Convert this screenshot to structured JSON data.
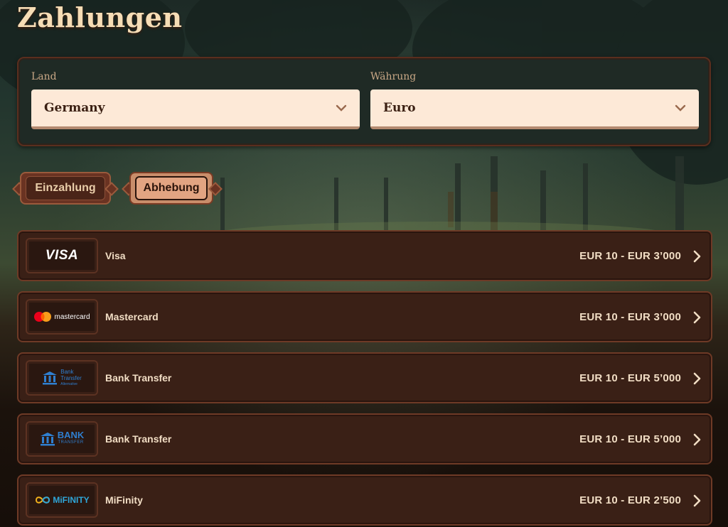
{
  "page": {
    "title": "Zahlungen"
  },
  "filters": {
    "country": {
      "label": "Land",
      "value": "Germany",
      "icon": "chevron-down-icon"
    },
    "currency": {
      "label": "Währung",
      "value": "Euro",
      "icon": "chevron-down-icon"
    }
  },
  "tabs": [
    {
      "label": "Einzahlung",
      "active": false
    },
    {
      "label": "Abhebung",
      "active": true
    }
  ],
  "methods": [
    {
      "logo": "VISA",
      "name": "Visa",
      "limits": "EUR 10 - EUR 3’000"
    },
    {
      "logo": "mastercard",
      "name": "Mastercard",
      "limits": "EUR 10 - EUR 3’000"
    },
    {
      "logo": "Bank Transfer Alternative",
      "logo_lines": [
        "Bank",
        "Transfer",
        "Alternative"
      ],
      "name": "Bank Transfer",
      "limits": "EUR 10 - EUR 5’000"
    },
    {
      "logo": "BANK TRANSFER",
      "logo_lines": [
        "BANK",
        "TRANSFER"
      ],
      "name": "Bank Transfer",
      "limits": "EUR 10 - EUR 5’000"
    },
    {
      "logo": "MiFINITY",
      "name": "MiFinity",
      "limits": "EUR 10 - EUR 2’500"
    }
  ],
  "colors": {
    "accent": "#e2a482",
    "card_bg": "#3a2016",
    "input_bg": "#fde9d7",
    "bank_blue": "#2f7fd0"
  }
}
